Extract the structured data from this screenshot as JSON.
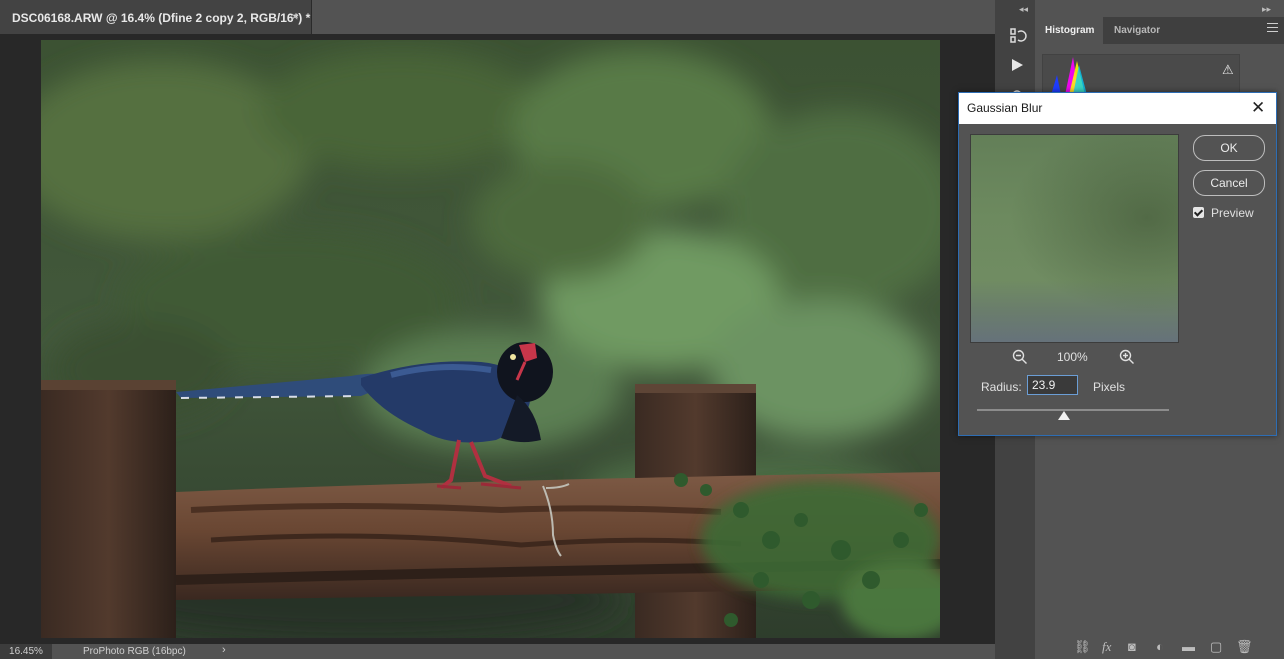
{
  "document": {
    "tab_title": "DSC06168.ARW @ 16.4% (Dfine 2 copy 2, RGB/16*) *",
    "close_glyph": "×"
  },
  "status": {
    "zoom": "16.45%",
    "profile": "ProPhoto RGB (16bpc)",
    "arrow": "›"
  },
  "panel": {
    "tabs": [
      "Histogram",
      "Navigator"
    ],
    "warning_icon": "warning-icon"
  },
  "dialog": {
    "title": "Gaussian Blur",
    "ok": "OK",
    "cancel": "Cancel",
    "preview_label": "Preview",
    "preview_checked": true,
    "zoom_level": "100%",
    "radius_label": "Radius:",
    "radius_value": "23.9",
    "units": "Pixels"
  },
  "colors": {
    "accent": "#2d6db4",
    "canvas_bg": "#282828",
    "panel_bg": "#535353"
  }
}
